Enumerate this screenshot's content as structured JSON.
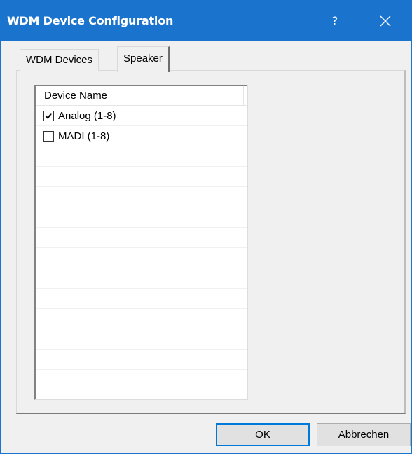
{
  "window": {
    "title": "WDM Device Configuration",
    "help_label": "?",
    "accent": "#1a73cc"
  },
  "tabs": [
    {
      "label": "WDM Devices",
      "active": false
    },
    {
      "label": "Speaker",
      "active": true
    }
  ],
  "device_list": {
    "column_header": "Device Name",
    "items": [
      {
        "label": "Analog (1-8)",
        "checked": true
      },
      {
        "label": "MADI (1-8)",
        "checked": false
      }
    ]
  },
  "buttons": {
    "ok_label": "OK",
    "cancel_label": "Abbrechen"
  }
}
